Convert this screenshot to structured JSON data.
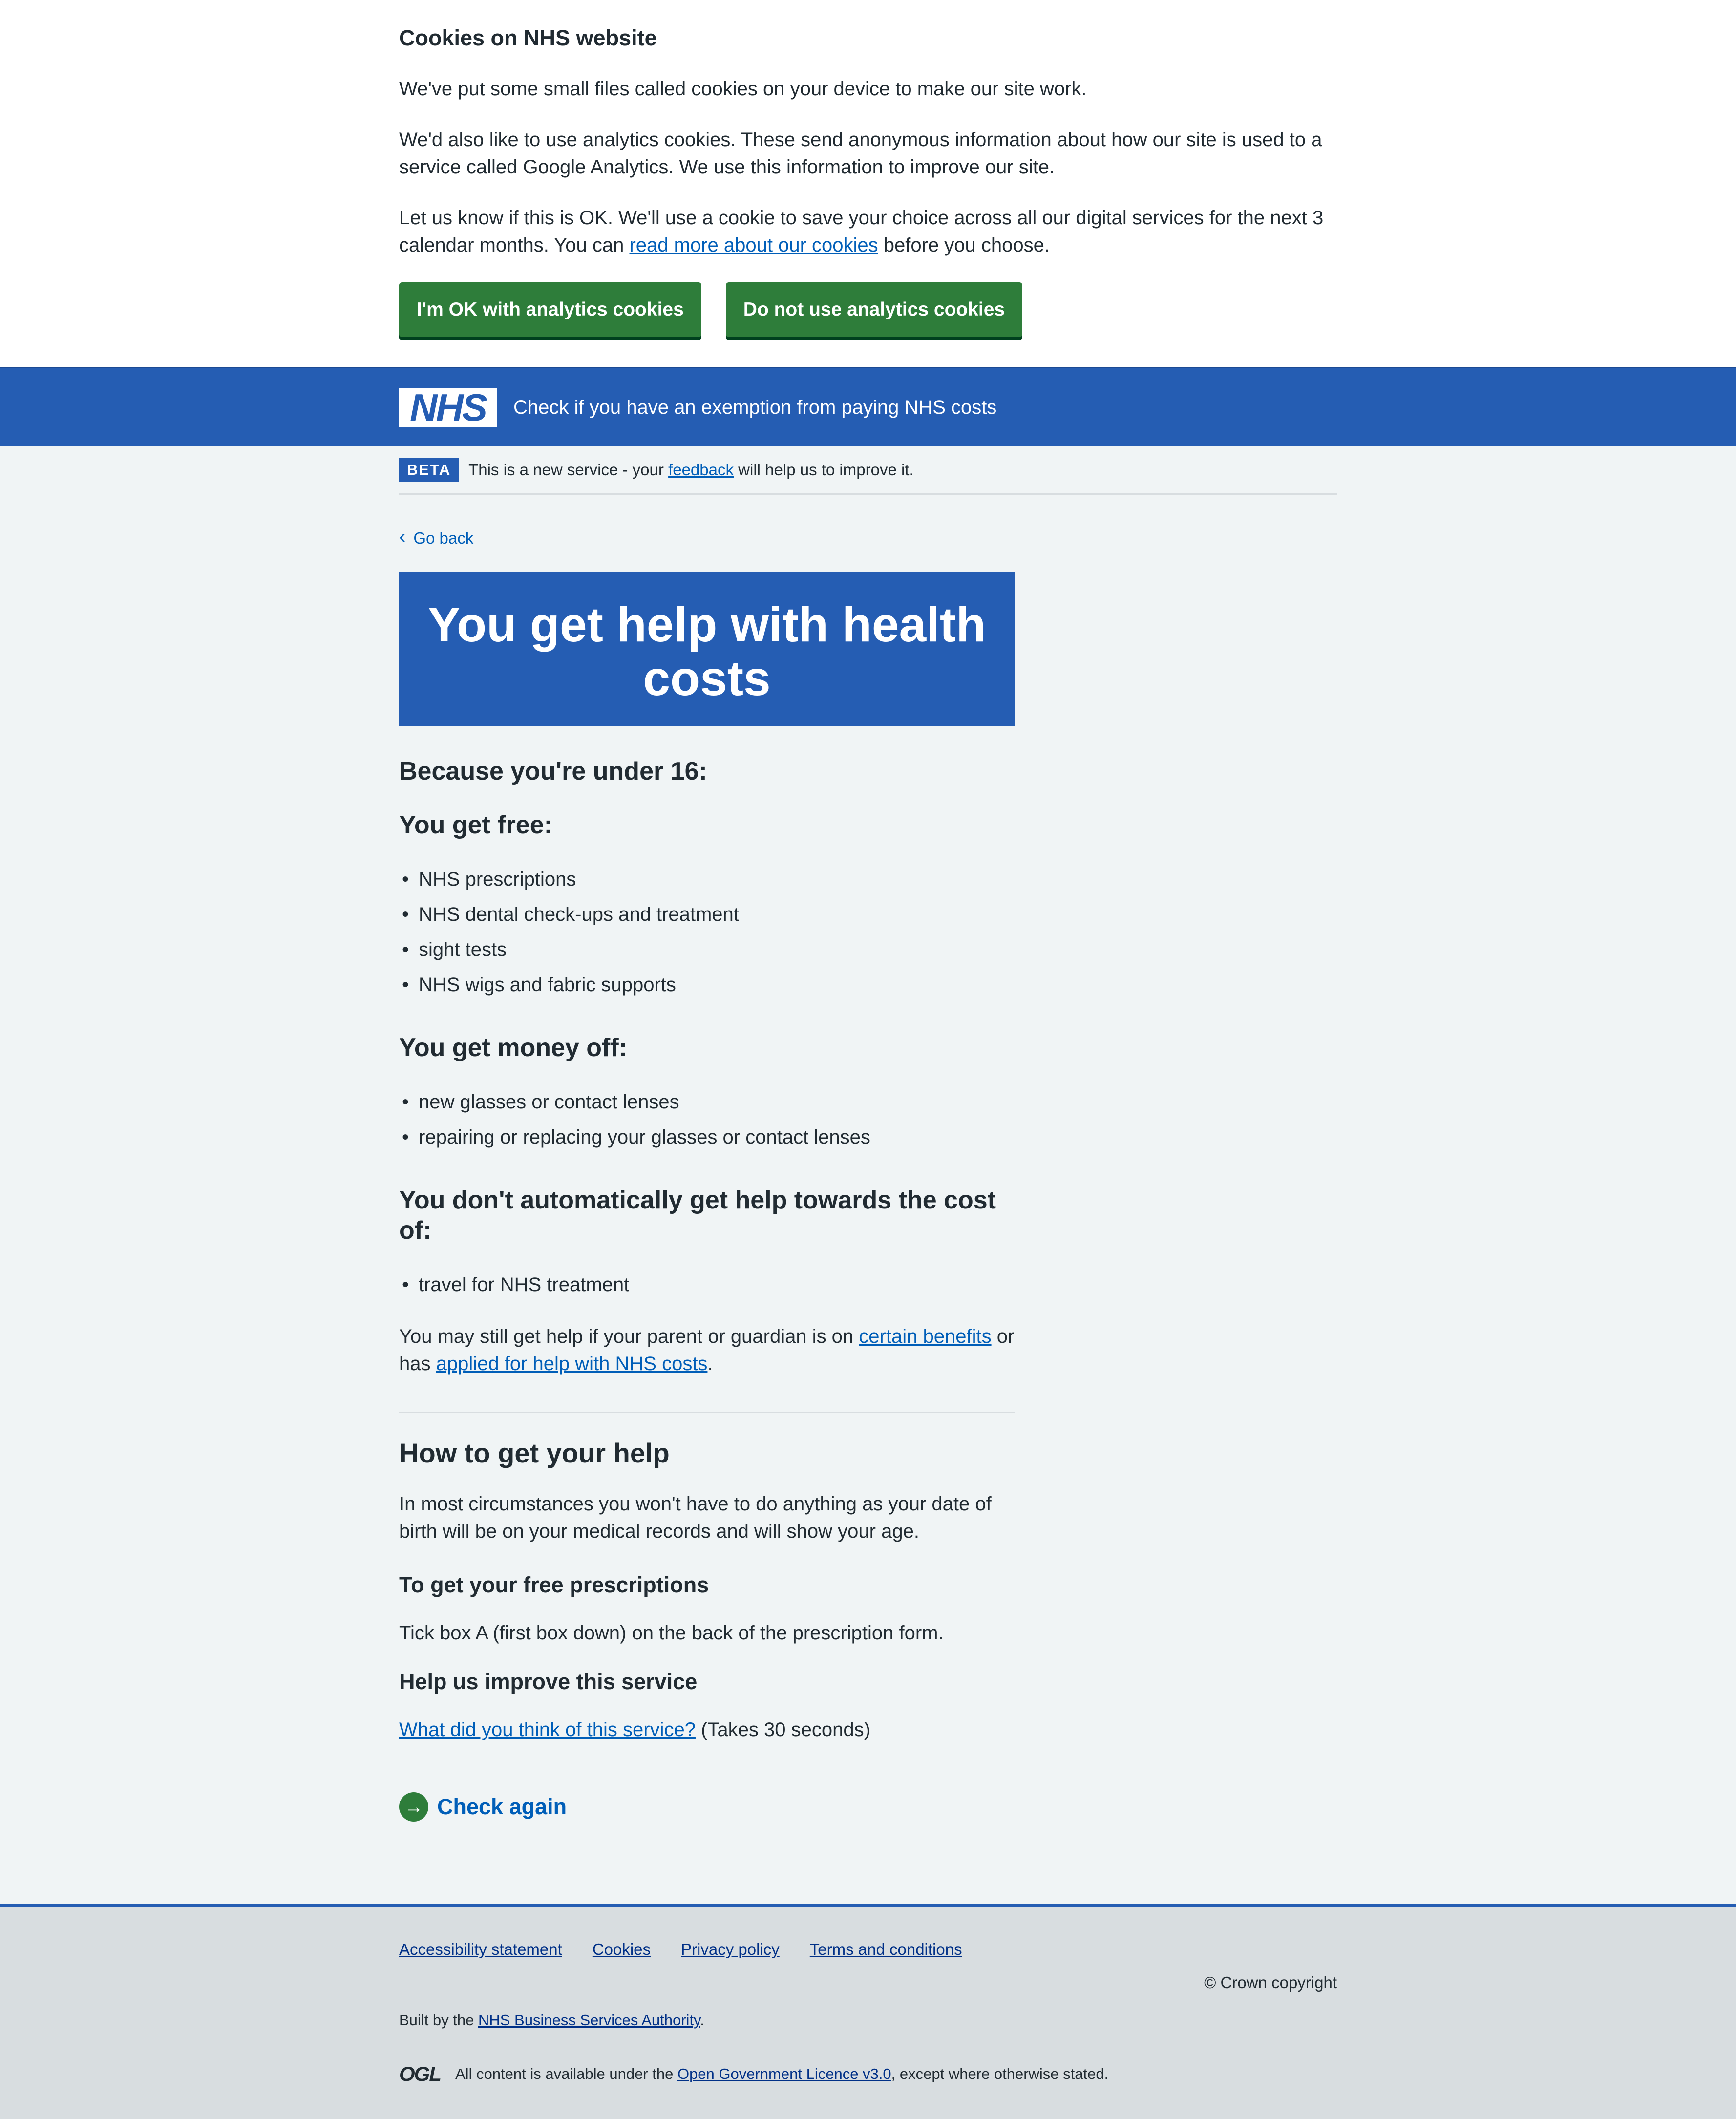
{
  "cookie_banner": {
    "heading": "Cookies on NHS website",
    "p1": "We've put some small files called cookies on your device to make our site work.",
    "p2": "We'd also like to use analytics cookies. These send anonymous information about how our site is used to a service called Google Analytics. We use this information to improve our site.",
    "p3_before": "Let us know if this is OK. We'll use a cookie to save your choice across all our digital services for the next 3 calendar months. You can ",
    "p3_link": "read more about our cookies",
    "p3_after": " before you choose.",
    "accept_label": "I'm OK with analytics cookies",
    "reject_label": "Do not use analytics cookies"
  },
  "header": {
    "logo_text": "NHS",
    "service_name": "Check if you have an exemption from paying NHS costs"
  },
  "phase_banner": {
    "tag": "BETA",
    "text_before": "This is a new service - your ",
    "link": "feedback",
    "text_after": " will help us to improve it."
  },
  "back_link": "Go back",
  "main": {
    "panel_title": "You get help with health costs",
    "reason": "Because you're under 16:",
    "free_heading": "You get free:",
    "free_items": [
      "NHS prescriptions",
      "NHS dental check-ups and treatment",
      "sight tests",
      "NHS wigs and fabric supports"
    ],
    "money_off_heading": "You get money off:",
    "money_off_items": [
      "new glasses or contact lenses",
      "repairing or replacing your glasses or contact lenses"
    ],
    "not_auto_heading": "You don't automatically get help towards the cost of:",
    "not_auto_items": [
      "travel for NHS treatment"
    ],
    "may_still_before": "You may still get help if your parent or guardian is on ",
    "may_still_link1": "certain benefits",
    "may_still_middle": " or has ",
    "may_still_link2": "applied for help with NHS costs",
    "may_still_after": ".",
    "how_heading": "How to get your help",
    "how_text": "In most circumstances you won't have to do anything as your date of birth will be on your medical records and will show your age.",
    "prescriptions_heading": "To get your free prescriptions",
    "prescriptions_text": "Tick box A (first box down) on the back of the prescription form.",
    "improve_heading": "Help us improve this service",
    "improve_link": "What did you think of this service?",
    "improve_after": " (Takes 30 seconds)",
    "check_again": "Check again"
  },
  "footer": {
    "links": [
      "Accessibility statement",
      "Cookies",
      "Privacy policy",
      "Terms and conditions"
    ],
    "copyright": "© Crown copyright",
    "built_before": "Built by the ",
    "built_link": "NHS Business Services Authority",
    "built_after": ".",
    "ogl_mark": "OGL",
    "licence_before": "All content is available under the ",
    "licence_link": "Open Government Licence v3.0",
    "licence_after": ", except where otherwise stated."
  },
  "colors": {
    "nhs_blue": "#255db3",
    "green_button": "#2e7d3a",
    "link": "#005eb8",
    "background": "#f0f4f5",
    "footer_bg": "#d8dde0"
  }
}
